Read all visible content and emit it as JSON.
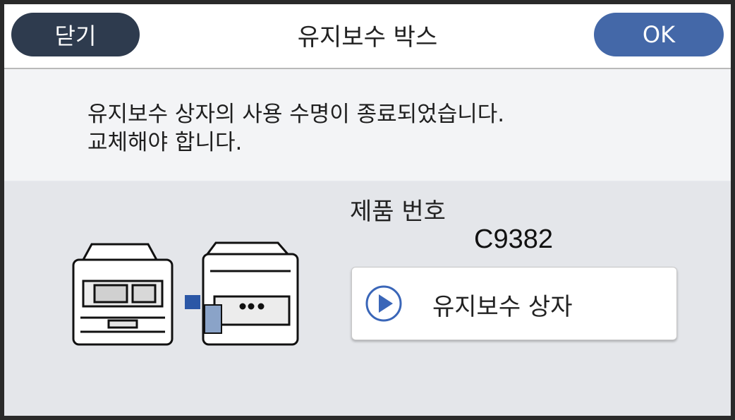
{
  "header": {
    "close_label": "닫기",
    "title": "유지보수 박스",
    "ok_label": "OK"
  },
  "message": {
    "text": "유지보수 상자의 사용 수명이 종료되었습니다.\n교체해야 합니다."
  },
  "product": {
    "label": "제품 번호",
    "code": "C9382"
  },
  "maintenance_button": {
    "label": "유지보수 상자",
    "icon": "play-icon"
  },
  "colors": {
    "close_button": "#2e3b4e",
    "ok_button": "#4468a8",
    "play_icon": "#3a66b8"
  }
}
